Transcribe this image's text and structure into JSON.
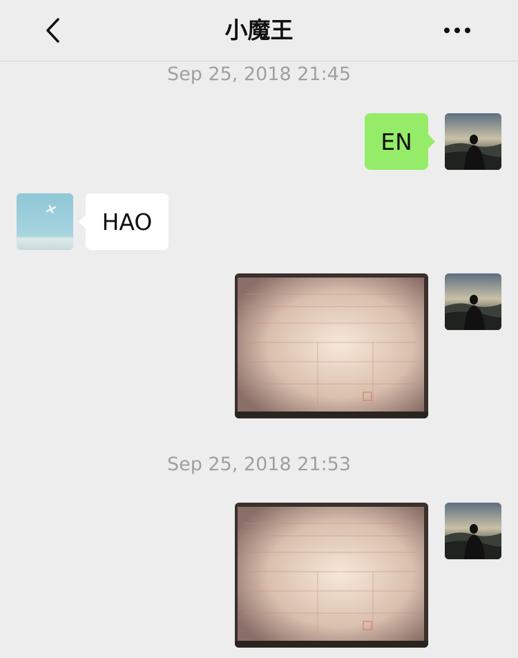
{
  "header": {
    "title": "小魔王",
    "back_icon": "chevron-left-icon",
    "more_icon": "more-dots-icon"
  },
  "messages": {
    "timestamp_1": "Sep 25, 2018 21:45",
    "msg_1_text": "EN",
    "msg_2_text": "HAO",
    "timestamp_2": "Sep 25, 2018 21:53"
  },
  "colors": {
    "background": "#ededed",
    "outgoing_bubble": "#95ec69",
    "incoming_bubble": "#ffffff",
    "timestamp_text": "#a0a0a0"
  }
}
